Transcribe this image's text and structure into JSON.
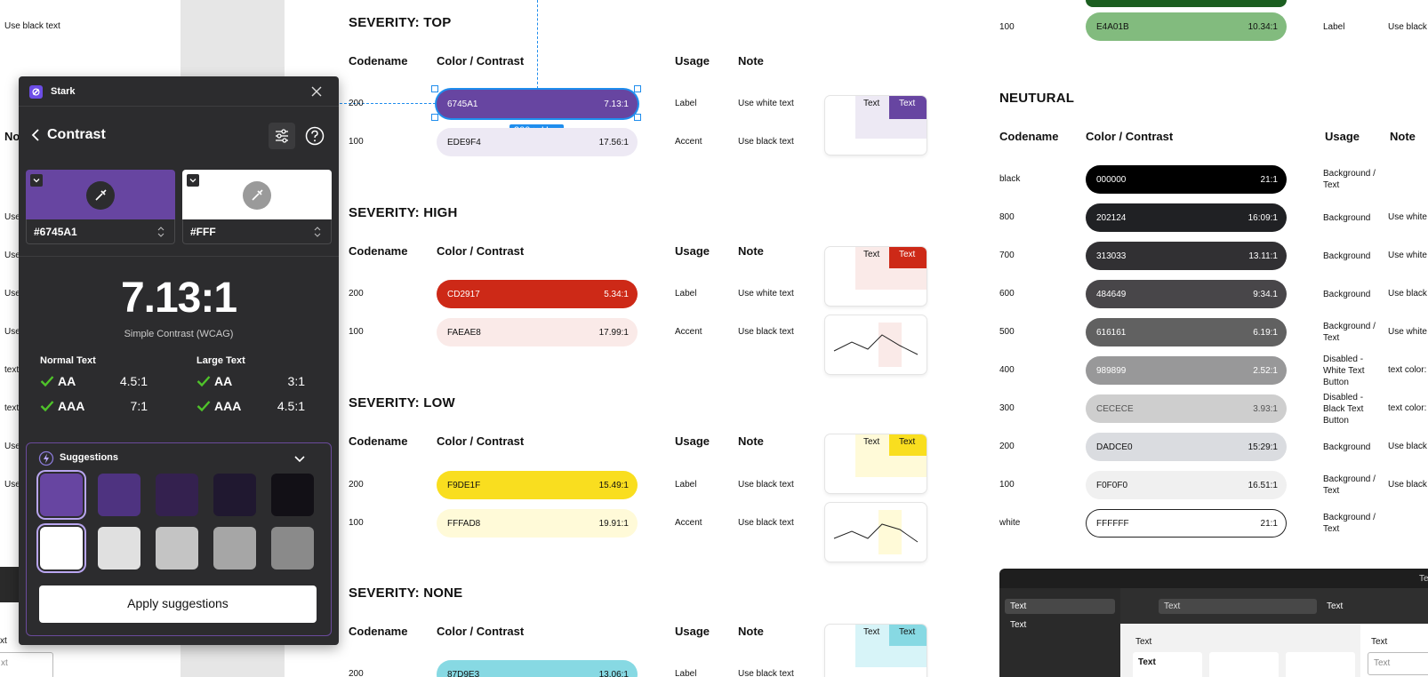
{
  "left_edge": {
    "use_black_text": "Use black text",
    "no_label": "No",
    "items": [
      "Use",
      "Use",
      "Use",
      "Use",
      "text",
      "text",
      "Use",
      "Use"
    ]
  },
  "severity_top": {
    "title": "SEVERITY: TOP",
    "headers": {
      "codename": "Codename",
      "color": "Color / Contrast",
      "usage": "Usage",
      "note": "Note"
    },
    "rows": [
      {
        "code": "200",
        "hex": "6745A1",
        "ratio": "7.13:1",
        "usage": "Label",
        "note": "Use white text"
      },
      {
        "code": "100",
        "hex": "EDE9F4",
        "ratio": "17.56:1",
        "usage": "Accent",
        "note": "Use black text"
      }
    ],
    "size_badge": "300 × Hug",
    "preview_text": "Text"
  },
  "severity_high": {
    "title": "SEVERITY: HIGH",
    "headers": {
      "codename": "Codename",
      "color": "Color / Contrast",
      "usage": "Usage",
      "note": "Note"
    },
    "rows": [
      {
        "code": "200",
        "hex": "CD2917",
        "ratio": "5.34:1",
        "usage": "Label",
        "note": "Use white text"
      },
      {
        "code": "100",
        "hex": "FAEAE8",
        "ratio": "17.99:1",
        "usage": "Accent",
        "note": "Use black text"
      }
    ],
    "preview_text": "Text"
  },
  "severity_low": {
    "title": "SEVERITY: LOW",
    "headers": {
      "codename": "Codename",
      "color": "Color / Contrast",
      "usage": "Usage",
      "note": "Note"
    },
    "rows": [
      {
        "code": "200",
        "hex": "F9DE1F",
        "ratio": "15.49:1",
        "usage": "Label",
        "note": "Use black text"
      },
      {
        "code": "100",
        "hex": "FFFAD8",
        "ratio": "19.91:1",
        "usage": "Accent",
        "note": "Use black text"
      }
    ],
    "preview_text": "Text"
  },
  "severity_none": {
    "title": "SEVERITY: NONE",
    "headers": {
      "codename": "Codename",
      "color": "Color / Contrast",
      "usage": "Usage",
      "note": "Note"
    },
    "rows": [
      {
        "code": "200",
        "hex": "87D9E3",
        "ratio": "13.06:1",
        "usage": "Label",
        "note": "Use black text"
      }
    ],
    "preview_text": "Text"
  },
  "top_right_row": {
    "code": "100",
    "hex": "E4A01B",
    "ratio": "10.34:1",
    "usage": "Label",
    "note": "Use black"
  },
  "neutral": {
    "title": "NEUTURAL",
    "headers": {
      "codename": "Codename",
      "color": "Color / Contrast",
      "usage": "Usage",
      "note": "Note"
    },
    "rows": [
      {
        "code": "black",
        "hex": "000000",
        "ratio": "21:1",
        "usage": "Background / Text",
        "note": "",
        "bg": "#000000",
        "fg": "#ffffff"
      },
      {
        "code": "800",
        "hex": "202124",
        "ratio": "16:09:1",
        "usage": "Background",
        "note": "Use white",
        "bg": "#202124",
        "fg": "#ffffff"
      },
      {
        "code": "700",
        "hex": "313033",
        "ratio": "13.11:1",
        "usage": "Background",
        "note": "Use white",
        "bg": "#313033",
        "fg": "#ffffff"
      },
      {
        "code": "600",
        "hex": "484649",
        "ratio": "9:34.1",
        "usage": "Background",
        "note": "Use black",
        "bg": "#484649",
        "fg": "#ffffff"
      },
      {
        "code": "500",
        "hex": "616161",
        "ratio": "6.19:1",
        "usage": "Background / Text",
        "note": "Use white",
        "bg": "#616161",
        "fg": "#ffffff"
      },
      {
        "code": "400",
        "hex": "989899",
        "ratio": "2.52:1",
        "usage": "Disabled - White Text Button",
        "note": "text color:",
        "bg": "#989899",
        "fg": "#ffffff"
      },
      {
        "code": "300",
        "hex": "CECECE",
        "ratio": "3.93:1",
        "usage": "Disabled - Black Text Button",
        "note": "text color:",
        "bg": "#cecece",
        "fg": "#555555"
      },
      {
        "code": "200",
        "hex": "DADCE0",
        "ratio": "15:29:1",
        "usage": "Background",
        "note": "Use black",
        "bg": "#dadce0",
        "fg": "#111111"
      },
      {
        "code": "100",
        "hex": "F0F0F0",
        "ratio": "16.51:1",
        "usage": "Background / Text",
        "note": "Use black",
        "bg": "#f0f0f0",
        "fg": "#111111"
      },
      {
        "code": "white",
        "hex": "FFFFFF",
        "ratio": "21:1",
        "usage": "Background / Text",
        "note": "",
        "bg": "#ffffff",
        "fg": "#111111"
      }
    ]
  },
  "stark": {
    "app_title": "Stark",
    "section": "Contrast",
    "fg_color": "#6745A1",
    "bg_color": "#FFF",
    "ratio": "7.13:1",
    "ratio_caption": "Simple Contrast (WCAG)",
    "normal_text": {
      "label": "Normal Text",
      "aa": "AA",
      "aa_value": "4.5:1",
      "aaa": "AAA",
      "aaa_value": "7:1"
    },
    "large_text": {
      "label": "Large Text",
      "aa": "AA",
      "aa_value": "3:1",
      "aaa": "AAA",
      "aaa_value": "4.5:1"
    },
    "suggestions_label": "Suggestions",
    "suggestion_colors_row1": [
      "#6745a1",
      "#4e3380",
      "#34214f",
      "#201830",
      "#121016"
    ],
    "suggestion_colors_row2": [
      "#ffffff",
      "#e0e0e0",
      "#c4c4c4",
      "#a6a6a6",
      "#8a8a8a"
    ],
    "apply_button": "Apply suggestions"
  },
  "dark_panel": {
    "top_label": "Te",
    "sidebar_items": [
      "Text",
      "Text"
    ],
    "search_text": "Text",
    "header_text": "Text",
    "col_header": "Text",
    "cell_text": "Text",
    "right_label": "Text",
    "right_input": "Text"
  },
  "bottom_left": {
    "label": "xt",
    "input": "xt"
  },
  "colors": {
    "accent_purple": "#6745A1",
    "selection_blue": "#1f8ded",
    "check_green": "#4fc32a"
  }
}
